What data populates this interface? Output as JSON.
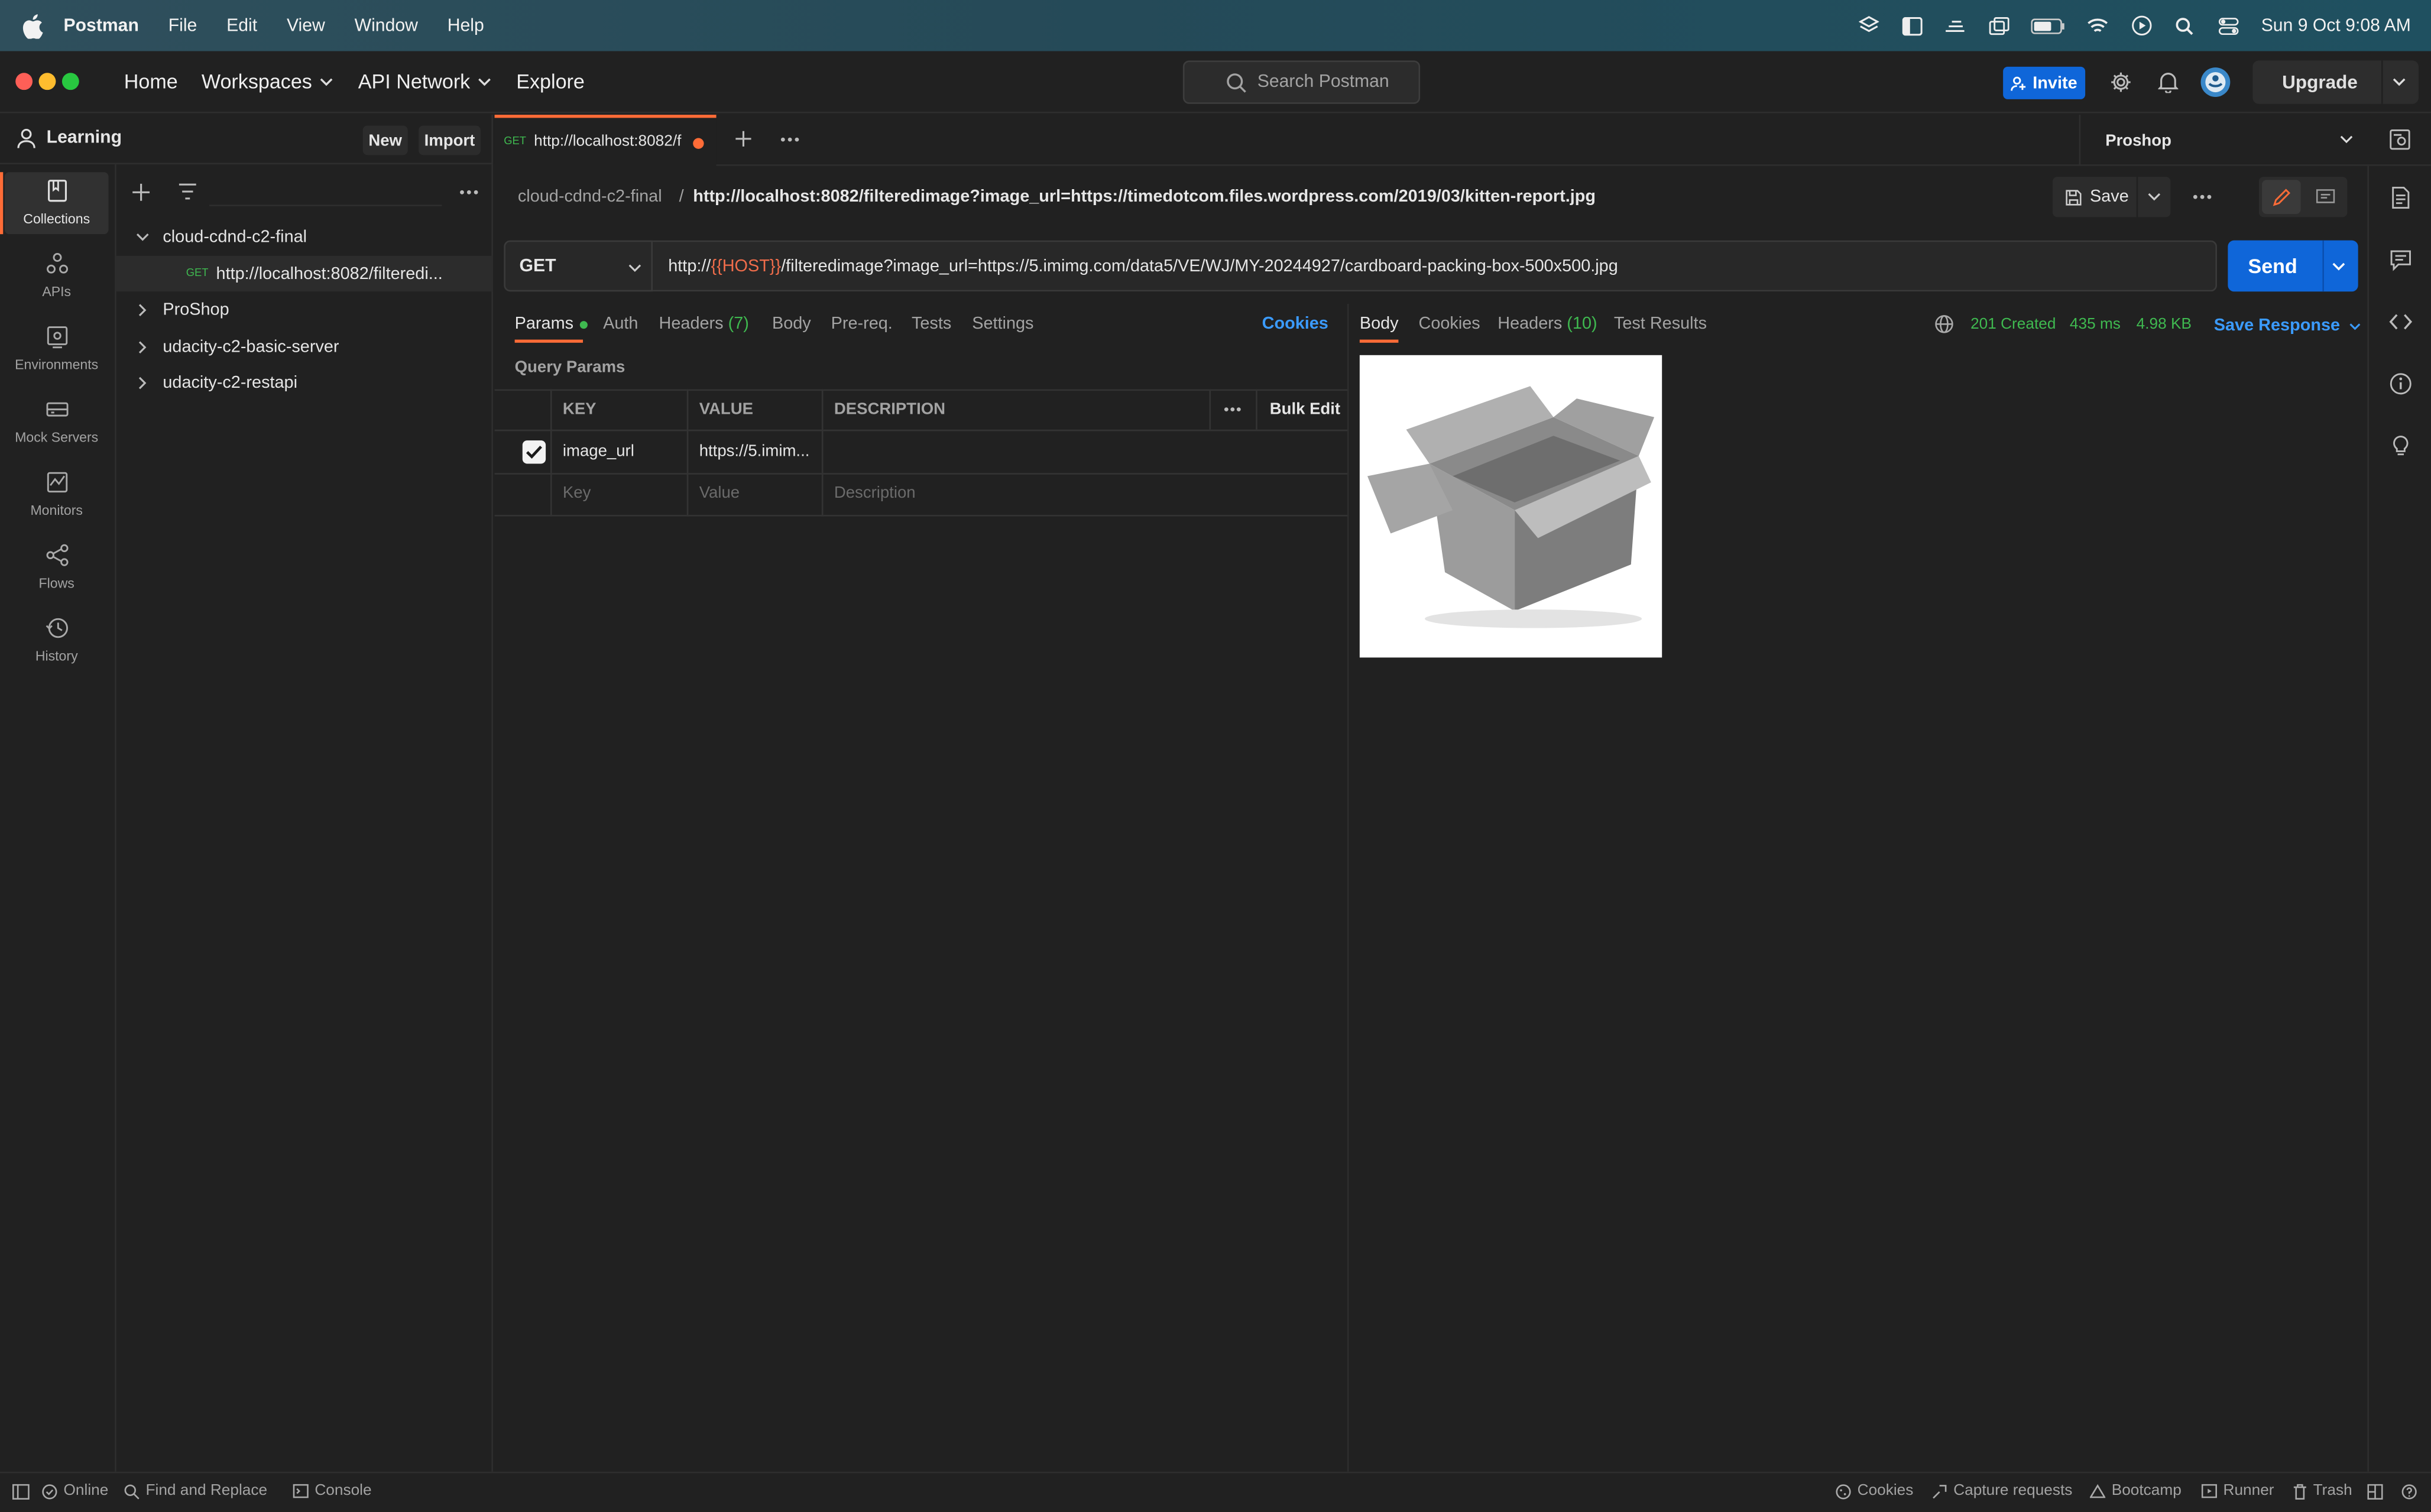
{
  "menubar": {
    "app_name": "Postman",
    "menus": [
      "File",
      "Edit",
      "View",
      "Window",
      "Help"
    ],
    "clock": "Sun 9 Oct  9:08 AM"
  },
  "header": {
    "nav": {
      "home": "Home",
      "workspaces": "Workspaces",
      "api_network": "API Network",
      "explore": "Explore"
    },
    "search_placeholder": "Search Postman",
    "invite_label": "Invite",
    "upgrade_label": "Upgrade"
  },
  "workspace": {
    "name": "Learning",
    "new_label": "New",
    "import_label": "Import"
  },
  "sidebar": {
    "items": [
      {
        "label": "Collections",
        "icon": "collections-icon"
      },
      {
        "label": "APIs",
        "icon": "apis-icon"
      },
      {
        "label": "Environments",
        "icon": "environments-icon"
      },
      {
        "label": "Mock Servers",
        "icon": "mock-servers-icon"
      },
      {
        "label": "Monitors",
        "icon": "monitors-icon"
      },
      {
        "label": "Flows",
        "icon": "flows-icon"
      },
      {
        "label": "History",
        "icon": "history-icon"
      }
    ]
  },
  "collections": {
    "tree": [
      {
        "label": "cloud-cdnd-c2-final",
        "expanded": true
      },
      {
        "method": "GET",
        "label": "http://localhost:8082/filteredi..."
      },
      {
        "label": "ProShop",
        "expanded": false
      },
      {
        "label": "udacity-c2-basic-server",
        "expanded": false
      },
      {
        "label": "udacity-c2-restapi",
        "expanded": false
      }
    ]
  },
  "tab": {
    "method": "GET",
    "label": "http://localhost:8082/f"
  },
  "environment": {
    "selected": "Proshop"
  },
  "breadcrumb": {
    "collection": "cloud-cdnd-c2-final",
    "separator": "/",
    "request": "http://localhost:8082/filteredimage?image_url=https://timedotcom.files.wordpress.com/2019/03/kitten-report.jpg"
  },
  "toolbar": {
    "save_label": "Save"
  },
  "request": {
    "method": "GET",
    "url_prefix": "http://",
    "url_variable": "{{HOST}}",
    "url_suffix": "/filteredimage?image_url=https://5.imimg.com/data5/VE/WJ/MY-20244927/cardboard-packing-box-500x500.jpg",
    "send_label": "Send",
    "tabs": [
      "Params",
      "Auth",
      "Headers",
      "Body",
      "Pre-req.",
      "Tests",
      "Settings"
    ],
    "headers_count": "(7)",
    "cookies_label": "Cookies",
    "query_params_title": "Query Params",
    "columns": [
      "KEY",
      "VALUE",
      "DESCRIPTION"
    ],
    "bulk_edit_label": "Bulk Edit",
    "params": [
      {
        "checked": true,
        "key": "image_url",
        "value": "https://5.imim...",
        "description": ""
      }
    ],
    "placeholders": {
      "key": "Key",
      "value": "Value",
      "description": "Description"
    }
  },
  "response": {
    "tabs": [
      "Body",
      "Cookies",
      "Headers",
      "Test Results"
    ],
    "headers_count": "(10)",
    "status": "201 Created",
    "time": "435 ms",
    "size": "4.98 KB",
    "save_response_label": "Save Response",
    "image_alt": "cardboard-box-image"
  },
  "statusbar": {
    "online": "Online",
    "find_replace": "Find and Replace",
    "console": "Console",
    "cookies": "Cookies",
    "capture": "Capture requests",
    "bootcamp": "Bootcamp",
    "runner": "Runner",
    "trash": "Trash"
  },
  "colors": {
    "accent": "#ff6c37",
    "primary": "#0f66d9",
    "status_ok": "#3fb950",
    "variable": "#f06d4b"
  }
}
